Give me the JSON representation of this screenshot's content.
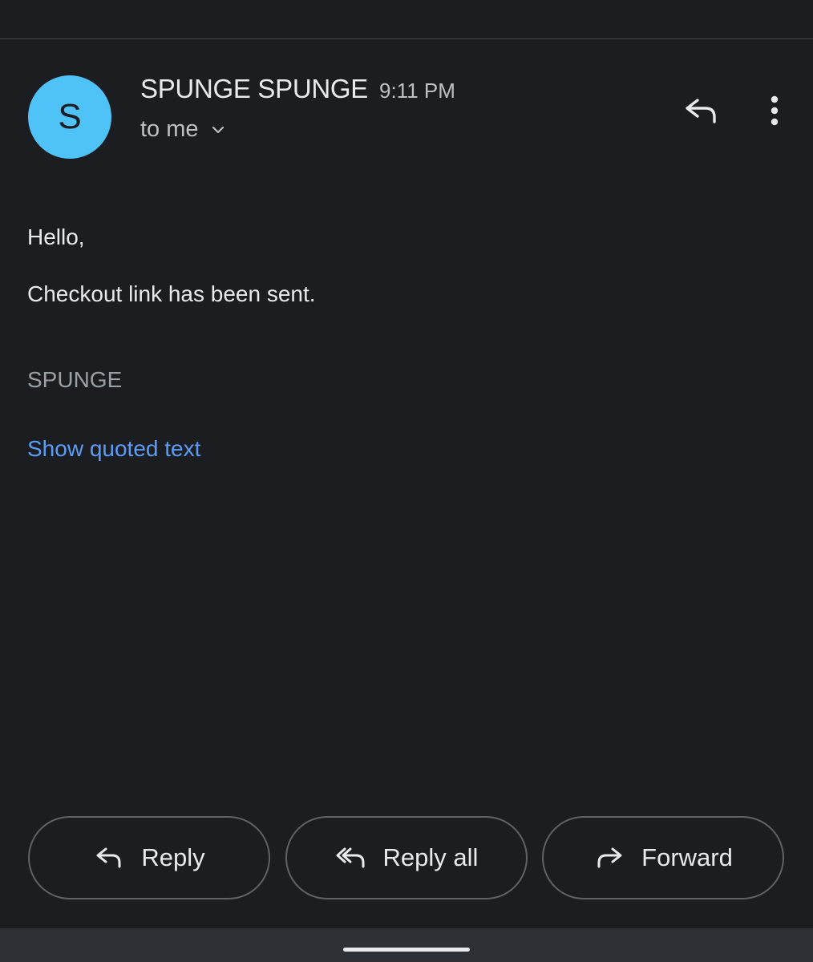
{
  "header": {
    "avatar_initial": "S",
    "avatar_color": "#4fc3f7",
    "sender_name": "SPUNGE SPUNGE",
    "time": "9:11 PM",
    "recipient_label": "to me",
    "recipient_icon": "chevron-down-icon",
    "reply_icon": "reply-icon",
    "more_icon": "more-vert-icon"
  },
  "message": {
    "greeting": "Hello,",
    "body": "Checkout link has been sent.",
    "signature": "SPUNGE",
    "quoted_link": "Show quoted text",
    "link_color": "#5b9cf5"
  },
  "actions": {
    "reply_label": "Reply",
    "reply_icon": "reply-icon",
    "reply_all_label": "Reply all",
    "reply_all_icon": "reply-all-icon",
    "forward_label": "Forward",
    "forward_icon": "forward-icon"
  },
  "theme": {
    "background": "#1b1d20",
    "text": "#e8eaed",
    "secondary_text": "#bdc1c6"
  }
}
